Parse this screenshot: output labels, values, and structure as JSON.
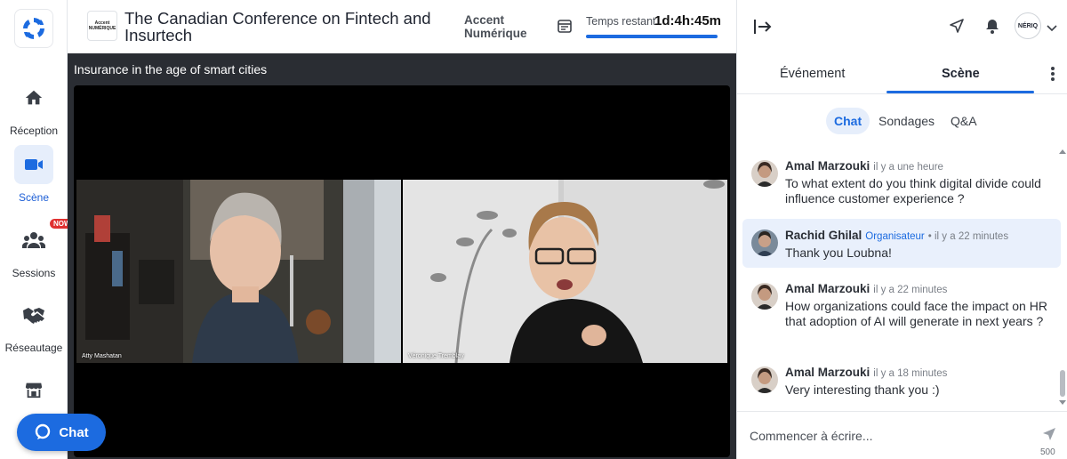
{
  "nav": {
    "items": [
      {
        "label": "Réception",
        "icon": "home-icon"
      },
      {
        "label": "Scène",
        "icon": "video-camera-icon"
      },
      {
        "label": "Sessions",
        "icon": "people-icon",
        "badge": "NOW"
      },
      {
        "label": "Réseautage",
        "icon": "handshake-icon"
      },
      {
        "label": "",
        "icon": "store-icon"
      }
    ],
    "chat_button": "Chat"
  },
  "header": {
    "event_logo_text": "Accent NUMÉRIQUE",
    "event_title": "The Canadian Conference on Fintech and Insurtech",
    "organizer": "Accent Numérique",
    "time_label": "Temps restant",
    "time_value": "1d:4h:45m",
    "progress_percent": 100
  },
  "stage": {
    "session_title": "Insurance in the age of smart cities",
    "participants": [
      {
        "name": "Atty Mashatan"
      },
      {
        "name": "Véronique Tremblay"
      }
    ]
  },
  "panel": {
    "avatar_text": "NÉRIQ",
    "tabs": [
      "Événement",
      "Scène"
    ],
    "active_tab": "Scène",
    "subtabs": [
      "Chat",
      "Sondages",
      "Q&A"
    ],
    "active_subtab": "Chat",
    "messages": [
      {
        "author": "Amal Marzouki",
        "role": "",
        "time": "il y a une heure",
        "text": "To what extent do you think digital divide could influence customer experience ?"
      },
      {
        "author": "Rachid Ghilal",
        "role": "Organisateur",
        "time": "• il y a 22 minutes",
        "text": "Thank you Loubna!"
      },
      {
        "author": "Amal Marzouki",
        "role": "",
        "time": "il y a 22 minutes",
        "text": "How organizations could face the impact on HR that adoption of AI will generate in next years ?"
      },
      {
        "author": "Amal Marzouki",
        "role": "",
        "time": "il y a 18 minutes",
        "text": "Very interesting thank you :)"
      }
    ],
    "composer_placeholder": "Commencer à écrire...",
    "char_count": "500"
  },
  "colors": {
    "accent": "#1c6be0",
    "active_bg": "#e6eefb",
    "stage_bg": "#2a2d33"
  }
}
